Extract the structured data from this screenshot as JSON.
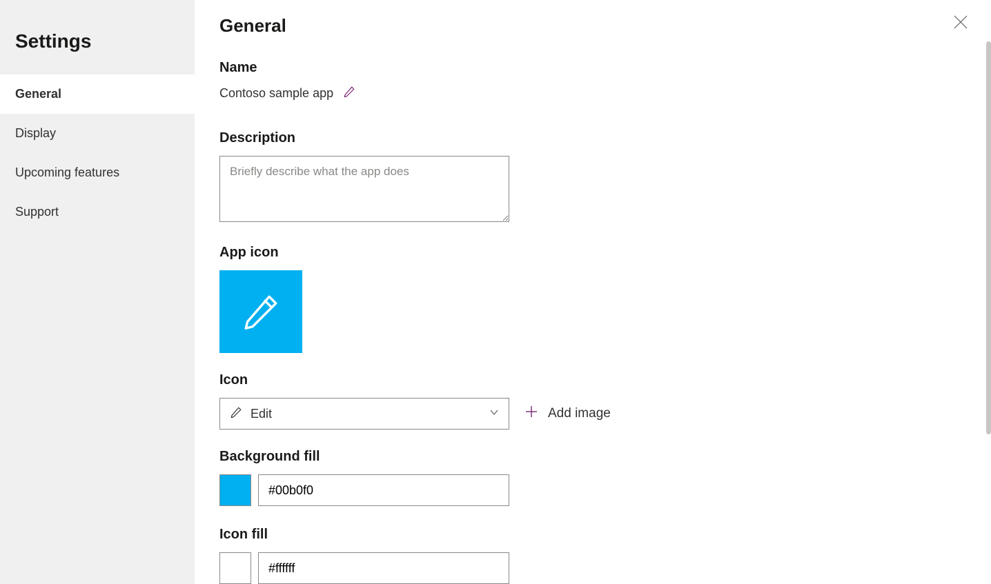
{
  "sidebar": {
    "title": "Settings",
    "items": [
      {
        "label": "General",
        "active": true
      },
      {
        "label": "Display",
        "active": false
      },
      {
        "label": "Upcoming features",
        "active": false
      },
      {
        "label": "Support",
        "active": false
      }
    ]
  },
  "header": {
    "title": "General"
  },
  "name_section": {
    "label": "Name",
    "value": "Contoso sample app"
  },
  "description_section": {
    "label": "Description",
    "placeholder": "Briefly describe what the app does",
    "value": ""
  },
  "app_icon_section": {
    "label": "App icon",
    "icon_name": "pencil-icon"
  },
  "icon_section": {
    "label": "Icon",
    "selected": "Edit",
    "add_image_label": "Add image"
  },
  "bg_fill_section": {
    "label": "Background fill",
    "value": "#00b0f0"
  },
  "icon_fill_section": {
    "label": "Icon fill",
    "value": "#ffffff"
  },
  "colors": {
    "accent": "#742774",
    "icon_bg": "#00b0f0",
    "icon_fg": "#ffffff"
  }
}
